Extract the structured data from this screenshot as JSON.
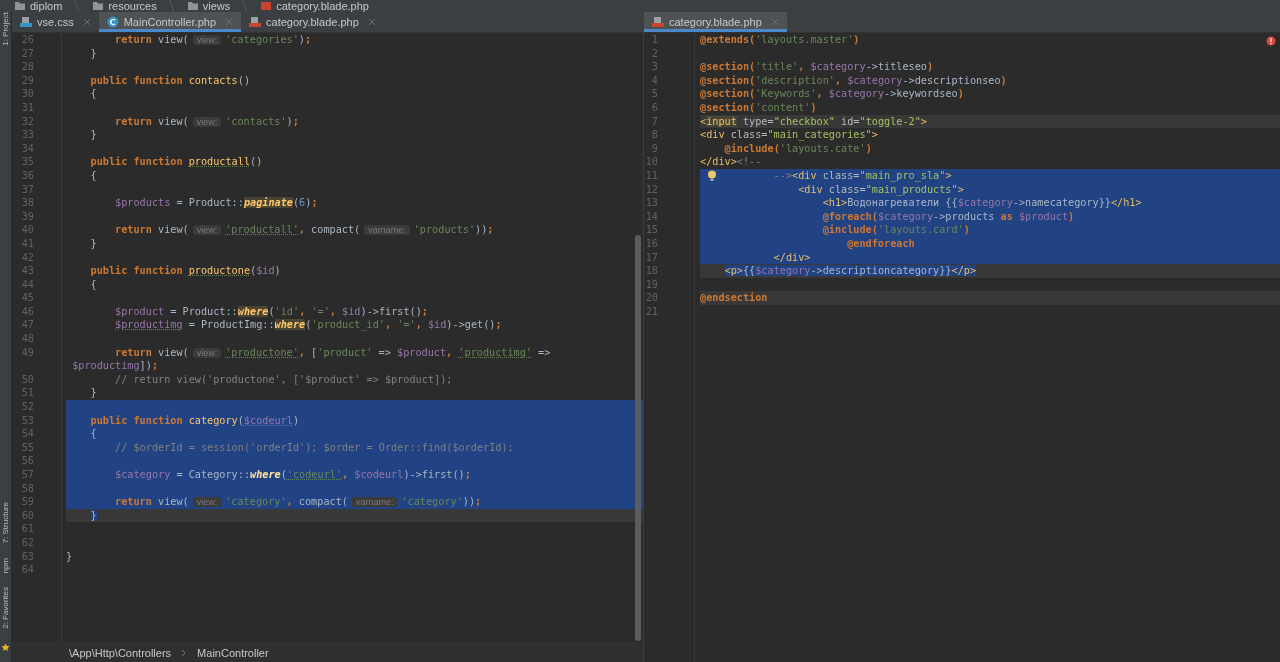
{
  "breadcrumbs": [
    {
      "label": "diplom",
      "kind": "project"
    },
    {
      "label": "resources",
      "kind": "folder"
    },
    {
      "label": "views",
      "kind": "folder"
    },
    {
      "label": "category.blade.php",
      "kind": "blade"
    }
  ],
  "tool_windows": [
    {
      "label": "1: Project",
      "kind": "top"
    },
    {
      "label": "7: Structure",
      "kind": "bottom"
    },
    {
      "label": "npm",
      "kind": "bottom"
    },
    {
      "label": "2: Favorites",
      "kind": "bottom"
    }
  ],
  "left_editor": {
    "tabs": [
      {
        "label": "vse.css",
        "kind": "css",
        "selected": false
      },
      {
        "label": "MainController.php",
        "kind": "class",
        "selected": true
      },
      {
        "label": "category.blade.php",
        "kind": "blade",
        "selected": false
      }
    ],
    "lines": [
      {
        "number": "26",
        "selected": false,
        "current": false,
        "tokens": [
          {
            "text": "        return",
            "kind": "kw"
          },
          {
            "text": " view(",
            "kind": "p"
          },
          {
            "text": "view:",
            "kind": "hint"
          },
          {
            "text": "'categories'",
            "kind": "str"
          },
          {
            "text": ")",
            "kind": "p"
          },
          {
            "text": ";",
            "kind": "kw"
          }
        ]
      },
      {
        "number": "27",
        "selected": false,
        "current": false,
        "tokens": [
          {
            "text": "    }",
            "kind": "p"
          }
        ]
      },
      {
        "number": "28",
        "selected": false,
        "current": false
      },
      {
        "number": "29",
        "selected": false,
        "current": false,
        "tokens": [
          {
            "text": "    public function ",
            "kind": "kw"
          },
          {
            "text": "contacts",
            "kind": "fn"
          },
          {
            "text": "()",
            "kind": "p"
          }
        ]
      },
      {
        "number": "30",
        "selected": false,
        "current": false,
        "tokens": [
          {
            "text": "    {",
            "kind": "p"
          }
        ]
      },
      {
        "number": "31",
        "selected": false,
        "current": false
      },
      {
        "number": "32",
        "selected": false,
        "current": false,
        "tokens": [
          {
            "text": "        return",
            "kind": "kw"
          },
          {
            "text": " view(",
            "kind": "p"
          },
          {
            "text": "view:",
            "kind": "hint"
          },
          {
            "text": "'contacts'",
            "kind": "str"
          },
          {
            "text": ")",
            "kind": "p"
          },
          {
            "text": ";",
            "kind": "kw"
          }
        ]
      },
      {
        "number": "33",
        "selected": false,
        "current": false,
        "tokens": [
          {
            "text": "    }",
            "kind": "p"
          }
        ]
      },
      {
        "number": "34",
        "selected": false,
        "current": false
      },
      {
        "number": "35",
        "selected": false,
        "current": false,
        "tokens": [
          {
            "text": "    public function ",
            "kind": "kw"
          },
          {
            "text": "productall",
            "kind": "fnu"
          },
          {
            "text": "()",
            "kind": "p"
          }
        ]
      },
      {
        "number": "36",
        "selected": false,
        "current": false,
        "tokens": [
          {
            "text": "    {",
            "kind": "p"
          }
        ]
      },
      {
        "number": "37",
        "selected": false,
        "current": false
      },
      {
        "number": "38",
        "selected": false,
        "current": false,
        "tokens": [
          {
            "text": "        $products",
            "kind": "var"
          },
          {
            "text": " = Product::",
            "kind": "p"
          },
          {
            "text": "paginate",
            "kind": "static"
          },
          {
            "text": "(",
            "kind": "p"
          },
          {
            "text": "6",
            "kind": "num"
          },
          {
            "text": ")",
            "kind": "p"
          },
          {
            "text": ";",
            "kind": "kw"
          }
        ]
      },
      {
        "number": "39",
        "selected": false,
        "current": false
      },
      {
        "number": "40",
        "selected": false,
        "current": false,
        "tokens": [
          {
            "text": "        return",
            "kind": "kw"
          },
          {
            "text": " view(",
            "kind": "p"
          },
          {
            "text": "view:",
            "kind": "hint"
          },
          {
            "text": "'productall'",
            "kind": "stru"
          },
          {
            "text": ", ",
            "kind": "kw"
          },
          {
            "text": "compact(",
            "kind": "p"
          },
          {
            "text": "varname:",
            "kind": "hint"
          },
          {
            "text": "'products'",
            "kind": "str"
          },
          {
            "text": "))",
            "kind": "p"
          },
          {
            "text": ";",
            "kind": "kw"
          }
        ]
      },
      {
        "number": "41",
        "selected": false,
        "current": false,
        "tokens": [
          {
            "text": "    }",
            "kind": "p"
          }
        ]
      },
      {
        "number": "42",
        "selected": false,
        "current": false
      },
      {
        "number": "43",
        "selected": false,
        "current": false,
        "tokens": [
          {
            "text": "    public function ",
            "kind": "kw"
          },
          {
            "text": "productone",
            "kind": "fnu"
          },
          {
            "text": "(",
            "kind": "p"
          },
          {
            "text": "$id",
            "kind": "var"
          },
          {
            "text": ")",
            "kind": "p"
          }
        ]
      },
      {
        "number": "44",
        "selected": false,
        "current": false,
        "tokens": [
          {
            "text": "    {",
            "kind": "p"
          }
        ]
      },
      {
        "number": "45",
        "selected": false,
        "current": false
      },
      {
        "number": "46",
        "selected": false,
        "current": false,
        "tokens": [
          {
            "text": "        $product",
            "kind": "var"
          },
          {
            "text": " = Product::",
            "kind": "p"
          },
          {
            "text": "where",
            "kind": "static"
          },
          {
            "text": "(",
            "kind": "p"
          },
          {
            "text": "'id'",
            "kind": "str"
          },
          {
            "text": ", ",
            "kind": "kw"
          },
          {
            "text": "'='",
            "kind": "str"
          },
          {
            "text": ", ",
            "kind": "kw"
          },
          {
            "text": "$id",
            "kind": "var"
          },
          {
            "text": ")->first()",
            "kind": "p"
          },
          {
            "text": ";",
            "kind": "kw"
          }
        ]
      },
      {
        "number": "47",
        "selected": false,
        "current": false,
        "tokens": [
          {
            "text": "        $productimg",
            "kind": "varu"
          },
          {
            "text": " = ProductImg::",
            "kind": "p"
          },
          {
            "text": "where",
            "kind": "static"
          },
          {
            "text": "(",
            "kind": "p"
          },
          {
            "text": "'product_id'",
            "kind": "str"
          },
          {
            "text": ", ",
            "kind": "kw"
          },
          {
            "text": "'='",
            "kind": "str"
          },
          {
            "text": ", ",
            "kind": "kw"
          },
          {
            "text": "$id",
            "kind": "var"
          },
          {
            "text": ")->get()",
            "kind": "p"
          },
          {
            "text": ";",
            "kind": "kw"
          }
        ]
      },
      {
        "number": "48",
        "selected": false,
        "current": false
      },
      {
        "number": "49",
        "selected": false,
        "current": false,
        "tokens": [
          {
            "text": "        return",
            "kind": "kw"
          },
          {
            "text": " view(",
            "kind": "p"
          },
          {
            "text": "view:",
            "kind": "hint"
          },
          {
            "text": "'productone'",
            "kind": "stru"
          },
          {
            "text": ", ",
            "kind": "kw"
          },
          {
            "text": "[",
            "kind": "p"
          },
          {
            "text": "'product'",
            "kind": "str"
          },
          {
            "text": " => ",
            "kind": "p"
          },
          {
            "text": "$product",
            "kind": "var"
          },
          {
            "text": ", ",
            "kind": "kw"
          },
          {
            "text": "'productimg'",
            "kind": "stru"
          },
          {
            "text": " =>",
            "kind": "p"
          }
        ]
      },
      {
        "selected": false,
        "current": false,
        "tokens": [
          {
            "text": " $productimg",
            "kind": "var"
          },
          {
            "text": "])",
            "kind": "p"
          },
          {
            "text": ";",
            "kind": "kw"
          }
        ]
      },
      {
        "number": "50",
        "selected": false,
        "current": false,
        "tokens": [
          {
            "text": "        // return view('productone', ['$product' => $product]);",
            "kind": "cmt"
          }
        ]
      },
      {
        "number": "51",
        "selected": false,
        "current": false,
        "tokens": [
          {
            "text": "    }",
            "kind": "p"
          }
        ]
      },
      {
        "number": "52",
        "selected": true,
        "current": false
      },
      {
        "number": "53",
        "selected": true,
        "current": false,
        "tokens": [
          {
            "text": "    public function ",
            "kind": "kw"
          },
          {
            "text": "category",
            "kind": "fn"
          },
          {
            "text": "(",
            "kind": "p"
          },
          {
            "text": "$codeurl",
            "kind": "varu"
          },
          {
            "text": ")",
            "kind": "p"
          }
        ]
      },
      {
        "number": "54",
        "selected": true,
        "current": false,
        "tokens": [
          {
            "text": "    {",
            "kind": "p"
          }
        ]
      },
      {
        "number": "55",
        "selected": true,
        "current": false,
        "tokens": [
          {
            "text": "        // $orderId = session('orderId'); $order = Order::find($orderId);",
            "kind": "cmt"
          }
        ]
      },
      {
        "number": "56",
        "selected": true,
        "current": false
      },
      {
        "number": "57",
        "selected": true,
        "current": false,
        "tokens": [
          {
            "text": "        $category",
            "kind": "var"
          },
          {
            "text": " = Category::",
            "kind": "p"
          },
          {
            "text": "where",
            "kind": "static"
          },
          {
            "text": "(",
            "kind": "p"
          },
          {
            "text": "'codeurl'",
            "kind": "stru"
          },
          {
            "text": ", ",
            "kind": "kw"
          },
          {
            "text": "$codeurl",
            "kind": "var"
          },
          {
            "text": ")->first()",
            "kind": "p"
          },
          {
            "text": ";",
            "kind": "kw"
          }
        ]
      },
      {
        "number": "58",
        "selected": true,
        "current": false
      },
      {
        "number": "59",
        "selected": true,
        "current": false,
        "tokens": [
          {
            "text": "        return",
            "kind": "kw"
          },
          {
            "text": " view(",
            "kind": "p"
          },
          {
            "text": "view:",
            "kind": "hint"
          },
          {
            "text": "'category'",
            "kind": "str"
          },
          {
            "text": ", ",
            "kind": "kw"
          },
          {
            "text": "compact(",
            "kind": "p"
          },
          {
            "text": "varname:",
            "kind": "hint"
          },
          {
            "text": "'category'",
            "kind": "str"
          },
          {
            "text": "))",
            "kind": "p"
          },
          {
            "text": ";",
            "kind": "kw"
          }
        ]
      },
      {
        "number": "60",
        "selected": true,
        "current": true,
        "tokens": [
          {
            "text": "    }",
            "kind": "p"
          }
        ]
      },
      {
        "number": "61",
        "selected": false,
        "current": false
      },
      {
        "number": "62",
        "selected": false,
        "current": false
      },
      {
        "number": "63",
        "selected": false,
        "current": false,
        "tokens": [
          {
            "text": "}",
            "kind": "p"
          }
        ]
      },
      {
        "number": "64",
        "selected": false,
        "current": false
      }
    ],
    "path": [
      "\\App\\Http\\Controllers",
      "MainController"
    ]
  },
  "right_editor": {
    "tabs": [
      {
        "label": "category.blade.php",
        "kind": "blade",
        "selected": true
      }
    ],
    "lines": [
      {
        "number": "1",
        "selected": false,
        "current": false,
        "tokens": [
          {
            "text": "@extends",
            "kind": "blade"
          },
          {
            "text": "(",
            "kind": "kw"
          },
          {
            "text": "'layouts.master'",
            "kind": "str"
          },
          {
            "text": ")",
            "kind": "kw"
          }
        ]
      },
      {
        "number": "2",
        "selected": false,
        "current": false
      },
      {
        "number": "3",
        "selected": false,
        "current": false,
        "tokens": [
          {
            "text": "@section",
            "kind": "blade"
          },
          {
            "text": "(",
            "kind": "kw"
          },
          {
            "text": "'title'",
            "kind": "str"
          },
          {
            "text": ", ",
            "kind": "kw"
          },
          {
            "text": "$category",
            "kind": "var"
          },
          {
            "text": "->titleseo",
            "kind": "p"
          },
          {
            "text": ")",
            "kind": "kw"
          }
        ]
      },
      {
        "number": "4",
        "selected": false,
        "current": false,
        "tokens": [
          {
            "text": "@section",
            "kind": "blade"
          },
          {
            "text": "(",
            "kind": "kw"
          },
          {
            "text": "'description'",
            "kind": "str"
          },
          {
            "text": ", ",
            "kind": "kw"
          },
          {
            "text": "$category",
            "kind": "var"
          },
          {
            "text": "->descriptionseo",
            "kind": "p"
          },
          {
            "text": ")",
            "kind": "kw"
          }
        ]
      },
      {
        "number": "5",
        "selected": false,
        "current": false,
        "tokens": [
          {
            "text": "@section",
            "kind": "blade"
          },
          {
            "text": "(",
            "kind": "kw"
          },
          {
            "text": "'Keywords'",
            "kind": "str"
          },
          {
            "text": ", ",
            "kind": "kw"
          },
          {
            "text": "$category",
            "kind": "var"
          },
          {
            "text": "->keywordseo",
            "kind": "p"
          },
          {
            "text": ")",
            "kind": "kw"
          }
        ]
      },
      {
        "number": "6",
        "selected": false,
        "current": false,
        "tokens": [
          {
            "text": "@section",
            "kind": "blade"
          },
          {
            "text": "(",
            "kind": "kw"
          },
          {
            "text": "'content'",
            "kind": "str"
          },
          {
            "text": ")",
            "kind": "kw"
          }
        ]
      },
      {
        "number": "7",
        "selected": false,
        "current": true,
        "tokens": [
          {
            "text": "<",
            "kind": "tag"
          },
          {
            "text": "input",
            "kind": "taghl"
          },
          {
            "text": " type=",
            "kind": "attr"
          },
          {
            "text": "\"checkbox\"",
            "kind": "val"
          },
          {
            "text": " id=",
            "kind": "attr"
          },
          {
            "text": "\"toggle-2\"",
            "kind": "val"
          },
          {
            "text": ">",
            "kind": "tag"
          }
        ]
      },
      {
        "number": "8",
        "selected": false,
        "current": false,
        "tokens": [
          {
            "text": "<div",
            "kind": "tag"
          },
          {
            "text": " class=",
            "kind": "attr"
          },
          {
            "text": "\"main_categories\"",
            "kind": "val"
          },
          {
            "text": ">",
            "kind": "tag"
          }
        ]
      },
      {
        "number": "9",
        "selected": false,
        "current": false,
        "tokens": [
          {
            "text": "    @include",
            "kind": "blade"
          },
          {
            "text": "(",
            "kind": "kw"
          },
          {
            "text": "'layouts.cate'",
            "kind": "str"
          },
          {
            "text": ")",
            "kind": "kw"
          }
        ]
      },
      {
        "number": "10",
        "selected": false,
        "current": false,
        "tokens": [
          {
            "text": "</div>",
            "kind": "tag"
          },
          {
            "text": "<!--",
            "kind": "cmt"
          }
        ]
      },
      {
        "number": "11",
        "selected": true,
        "current": false,
        "tokens": [
          {
            "text": "            -->",
            "kind": "cmt"
          },
          {
            "text": "<div",
            "kind": "tag"
          },
          {
            "text": " class=",
            "kind": "attr"
          },
          {
            "text": "\"main_pro_sla\"",
            "kind": "val"
          },
          {
            "text": ">",
            "kind": "tag"
          }
        ]
      },
      {
        "number": "12",
        "selected": true,
        "current": false,
        "tokens": [
          {
            "text": "                <div",
            "kind": "tag"
          },
          {
            "text": " class=",
            "kind": "attr"
          },
          {
            "text": "\"main_products\"",
            "kind": "val"
          },
          {
            "text": ">",
            "kind": "tag"
          }
        ]
      },
      {
        "number": "13",
        "selected": true,
        "current": false,
        "tokens": [
          {
            "text": "                    <h1>",
            "kind": "tag"
          },
          {
            "text": "Водонагреватели {{",
            "kind": "p"
          },
          {
            "text": "$category",
            "kind": "var"
          },
          {
            "text": "->namecategory}}",
            "kind": "p"
          },
          {
            "text": "</h1>",
            "kind": "tag"
          }
        ]
      },
      {
        "number": "14",
        "selected": true,
        "current": false,
        "tokens": [
          {
            "text": "                    @foreach",
            "kind": "blade"
          },
          {
            "text": "(",
            "kind": "kw"
          },
          {
            "text": "$category",
            "kind": "var"
          },
          {
            "text": "->products ",
            "kind": "p"
          },
          {
            "text": "as",
            "kind": "kw"
          },
          {
            "text": " $product",
            "kind": "var"
          },
          {
            "text": ")",
            "kind": "kw"
          }
        ]
      },
      {
        "number": "15",
        "selected": true,
        "current": false,
        "tokens": [
          {
            "text": "                    @include",
            "kind": "blade"
          },
          {
            "text": "(",
            "kind": "kw"
          },
          {
            "text": "'layouts.card'",
            "kind": "str"
          },
          {
            "text": ")",
            "kind": "kw"
          }
        ]
      },
      {
        "number": "16",
        "selected": true,
        "current": false,
        "tokens": [
          {
            "text": "                        @endforeach",
            "kind": "blade"
          }
        ]
      },
      {
        "number": "17",
        "selected": true,
        "current": false,
        "tokens": [
          {
            "text": "            </div>",
            "kind": "tag"
          }
        ]
      },
      {
        "number": "18",
        "selected": true,
        "current": true,
        "tokens": [
          {
            "text": "    <p>",
            "kind": "tag"
          },
          {
            "text": "{{",
            "kind": "p"
          },
          {
            "text": "$category",
            "kind": "var"
          },
          {
            "text": "->descriptioncategory}}",
            "kind": "p"
          },
          {
            "text": "</p>",
            "kind": "tag"
          }
        ]
      },
      {
        "number": "19",
        "selected": false,
        "current": false
      },
      {
        "number": "20",
        "selected": false,
        "current": true,
        "tokens": [
          {
            "text": "@endsection",
            "kind": "blade"
          }
        ]
      },
      {
        "number": "21",
        "selected": false,
        "current": false
      }
    ]
  }
}
